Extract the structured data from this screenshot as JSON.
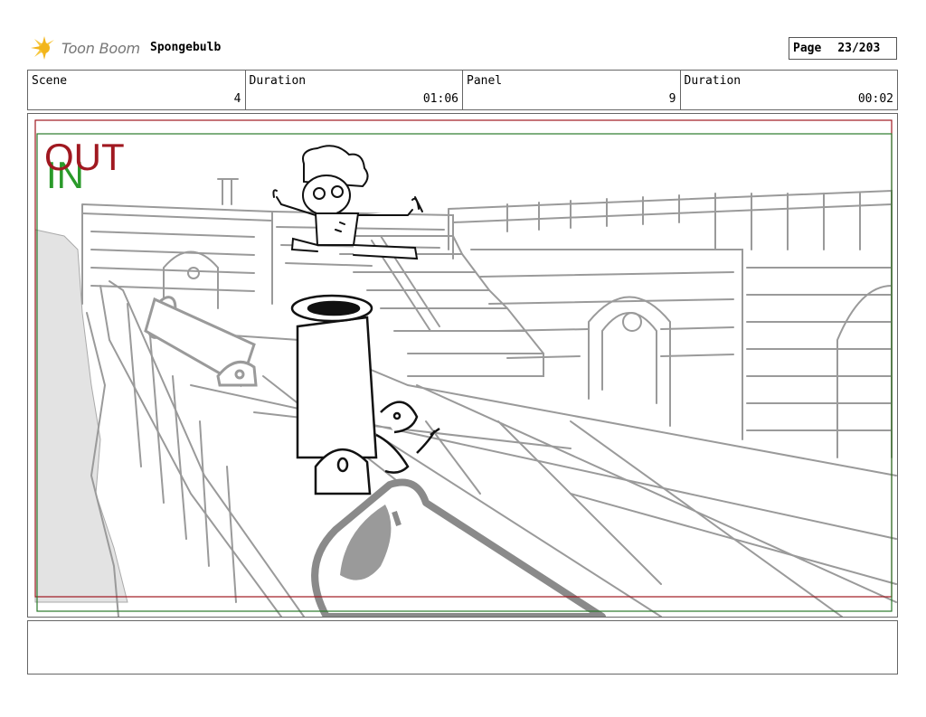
{
  "header": {
    "logo_text": "Toon Boom",
    "project_name": "Spongebulb",
    "page_label": "Page",
    "page_number": "23/203"
  },
  "info_row": {
    "scene_label": "Scene",
    "scene_value": "4",
    "scene_duration_label": "Duration",
    "scene_duration_value": "01:06",
    "panel_label": "Panel",
    "panel_value": "9",
    "panel_duration_label": "Duration",
    "panel_duration_value": "00:02"
  },
  "panel": {
    "frame_out_label": "OUT",
    "frame_in_label": "IN",
    "out_color": "#a01820",
    "in_color": "#2a9a2a"
  },
  "notes": {
    "text": ""
  }
}
